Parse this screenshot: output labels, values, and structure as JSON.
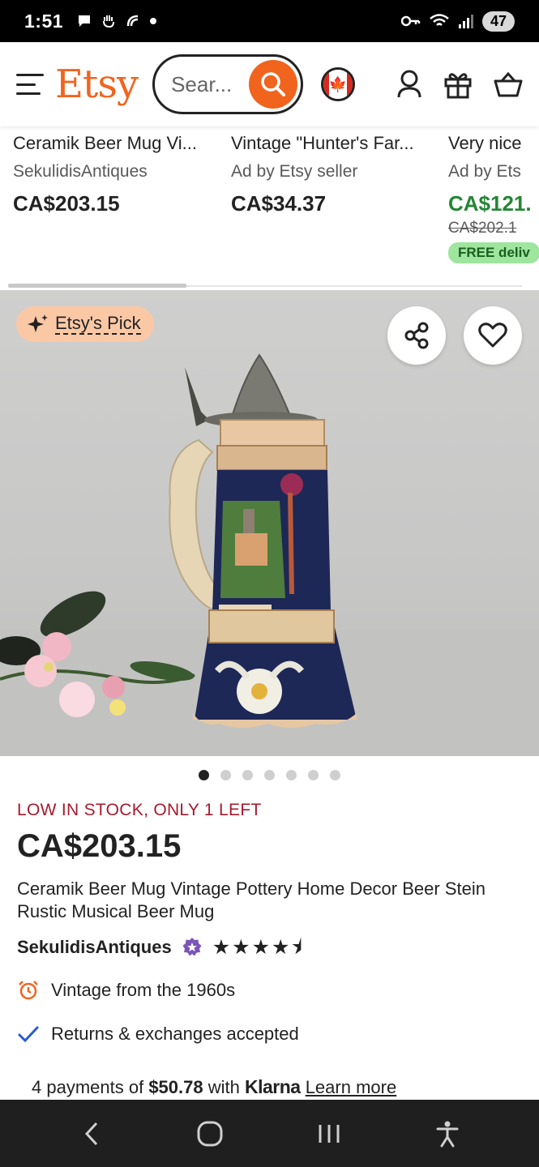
{
  "status_bar": {
    "time": "1:51",
    "battery": "47"
  },
  "header": {
    "logo": "Etsy",
    "search_placeholder": "Sear...",
    "accent_color": "#F1641E"
  },
  "recommended": [
    {
      "title": "Ceramik Beer Mug Vi...",
      "seller": "SekulidisAntiques",
      "price": "CA$203.15"
    },
    {
      "title": "Vintage \"Hunter's Far...",
      "seller": "Ad by Etsy seller",
      "price": "CA$34.37"
    },
    {
      "title": "Very nice",
      "seller": "Ad by Ets",
      "price": "CA$121.",
      "old_price": "CA$202.1",
      "badge": "FREE deliv"
    }
  ],
  "product": {
    "pick_label": "Etsy's Pick",
    "image_icons": [
      "share-icon",
      "heart-icon"
    ],
    "image_count": 7,
    "active_image": 0,
    "stock": "LOW IN STOCK, ONLY 1 LEFT",
    "price": "CA$203.15",
    "title": "Ceramik Beer Mug Vintage Pottery Home Decor Beer Stein Rustic Musical Beer Mug",
    "seller": "SekulidisAntiques",
    "rating": 4.5,
    "features": [
      {
        "icon": "alarm-clock-icon",
        "text": "Vintage from the 1960s"
      },
      {
        "icon": "checkmark-icon",
        "text": "Returns & exchanges accepted"
      }
    ],
    "klarna": {
      "prefix": "4 payments of ",
      "amount": "$50.78",
      "middle": " with ",
      "brand": "Klarna",
      "link": "Learn more"
    }
  },
  "nav_bar": {
    "icons": [
      "back-icon",
      "home-icon",
      "recents-icon",
      "accessibility-icon"
    ]
  }
}
